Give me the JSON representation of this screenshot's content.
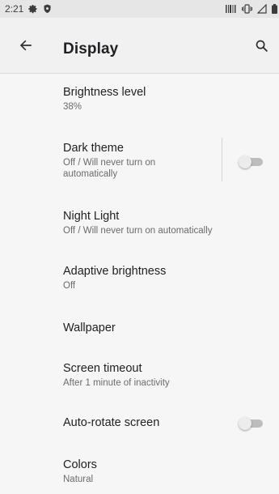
{
  "status_bar": {
    "time": "2:21",
    "left_icons": [
      "settings-icon",
      "shield-icon"
    ],
    "right_icons": [
      "barcode-icon",
      "vibrate-icon",
      "signal-icon",
      "battery-icon"
    ]
  },
  "app_bar": {
    "title": "Display",
    "back_icon": "arrow-back-icon",
    "search_icon": "search-icon"
  },
  "settings": [
    {
      "title": "Brightness level",
      "subtitle": "38%"
    },
    {
      "title": "Dark theme",
      "subtitle_line1": "Off / Will never turn on",
      "subtitle_line2": "automatically",
      "toggle": false
    },
    {
      "title": "Night Light",
      "subtitle": "Off / Will never turn on automatically"
    },
    {
      "title": "Adaptive brightness",
      "subtitle": "Off"
    },
    {
      "title": "Wallpaper"
    },
    {
      "title": "Screen timeout",
      "subtitle": "After 1 minute of inactivity"
    },
    {
      "title": "Auto-rotate screen",
      "toggle": false
    },
    {
      "title": "Colors",
      "subtitle": "Natural"
    }
  ],
  "colors": {
    "background": "#f6f6f6",
    "toggle_off_track": "#bdbdbd",
    "toggle_off_thumb": "#ececec"
  }
}
